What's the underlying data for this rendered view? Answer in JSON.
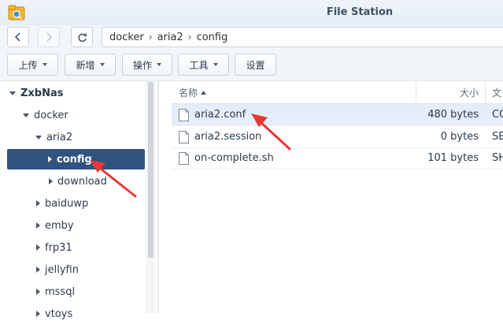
{
  "window": {
    "title": "File Station"
  },
  "nav": {
    "back_icon": "chevron-left-icon",
    "forward_icon": "chevron-right-icon",
    "refresh_icon": "refresh-icon",
    "path": [
      "docker",
      "aria2",
      "config"
    ]
  },
  "toolbar": {
    "upload": "上传",
    "new": "新增",
    "action": "操作",
    "tools": "工具",
    "settings": "设置"
  },
  "tree": [
    {
      "label": "ZxbNas",
      "expanded": true,
      "bold": true
    },
    {
      "label": "docker",
      "expanded": true
    },
    {
      "label": "aria2",
      "expanded": true
    },
    {
      "label": "config",
      "expanded": false,
      "selected": true
    },
    {
      "label": "download",
      "expanded": false
    },
    {
      "label": "baiduwp",
      "expanded": false
    },
    {
      "label": "emby",
      "expanded": false
    },
    {
      "label": "frp31",
      "expanded": false
    },
    {
      "label": "jellyfin",
      "expanded": false
    },
    {
      "label": "mssql",
      "expanded": false
    },
    {
      "label": "vtoys",
      "expanded": false
    }
  ],
  "columns": {
    "name": "名称",
    "size": "大小",
    "type": "文"
  },
  "files": [
    {
      "name": "aria2.conf",
      "size": "480 bytes",
      "type": "CO",
      "selected": true
    },
    {
      "name": "aria2.session",
      "size": "0 bytes",
      "type": "SE"
    },
    {
      "name": "on-complete.sh",
      "size": "101 bytes",
      "type": "SH"
    }
  ],
  "colors": {
    "selected_tree": "#30547f",
    "selected_row": "#e5eef8",
    "annotation_arrow": "#e53935"
  }
}
